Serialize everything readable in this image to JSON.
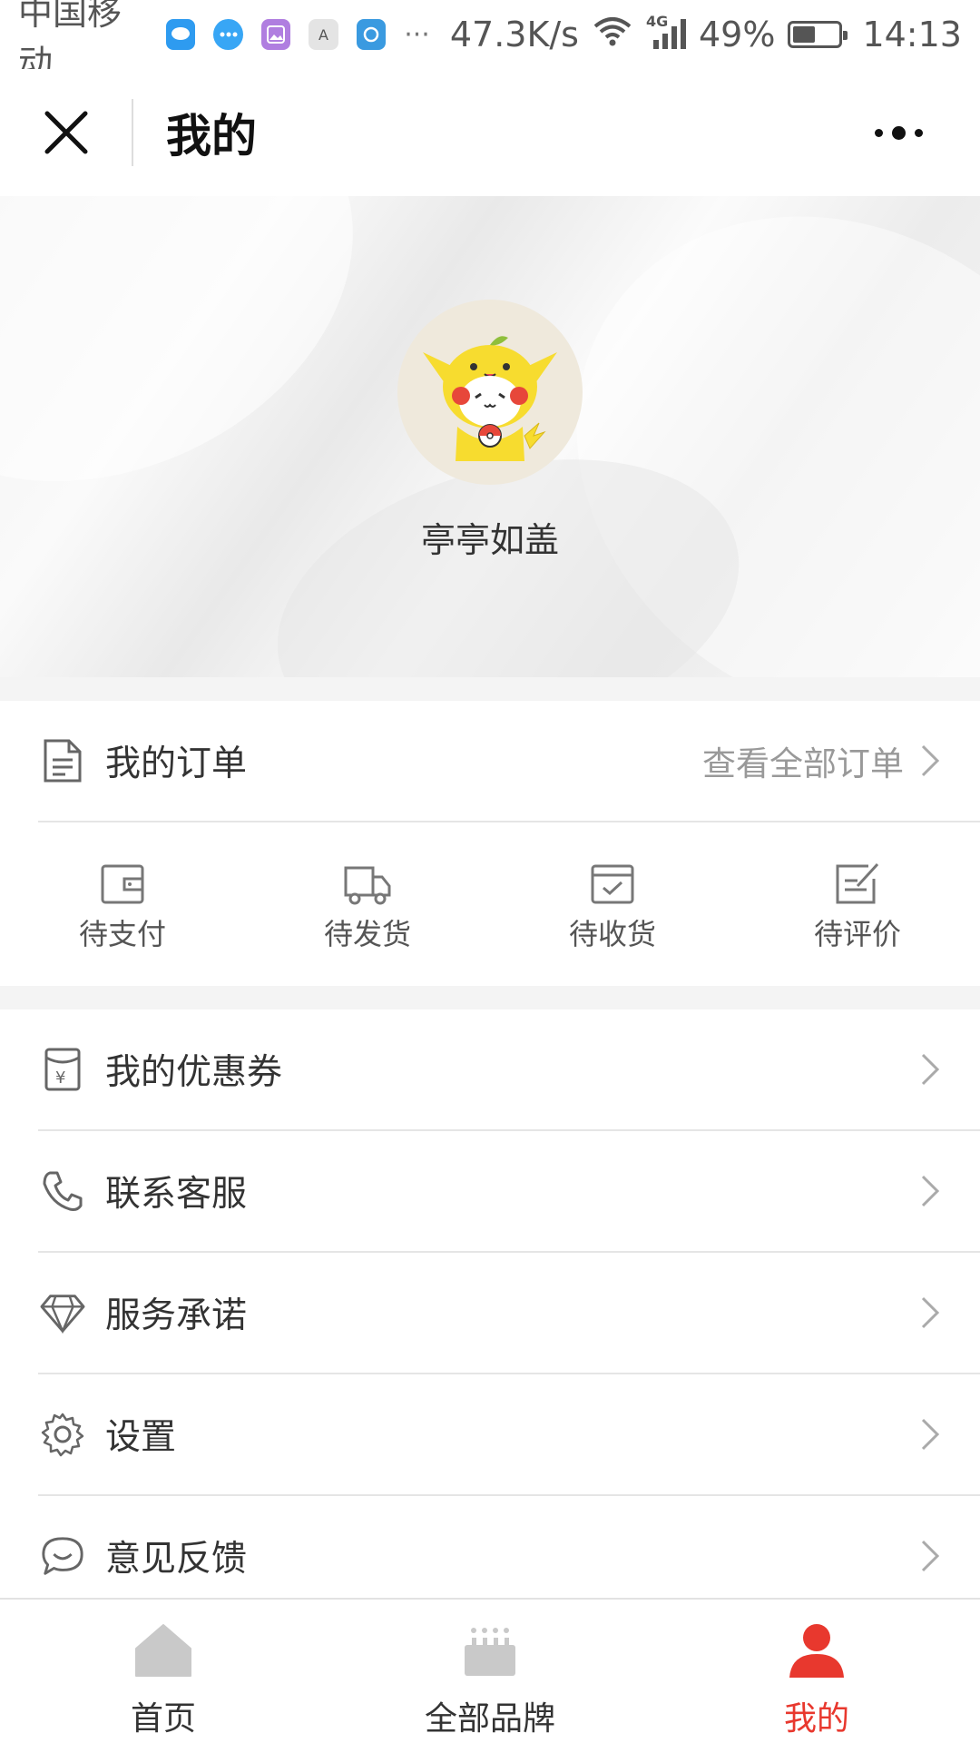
{
  "status_bar": {
    "carrier": "中国移动",
    "more": "···",
    "speed": "47.3K/s",
    "network": "4G",
    "battery": "49%",
    "battery_level": 0.49,
    "time": "14:13",
    "notification_icons": [
      "chat-bubble-icon",
      "message-icon",
      "gallery-icon",
      "keyboard-icon",
      "app-circle-icon"
    ]
  },
  "header": {
    "title": "我的",
    "close_icon": "close-icon",
    "more_icon": "more-dots-icon"
  },
  "profile": {
    "nickname": "亭亭如盖",
    "avatar_icon": "pikachu-avatar"
  },
  "orders": {
    "title": "我的订单",
    "view_all": "查看全部订单",
    "statuses": [
      {
        "label": "待支付",
        "icon": "wallet-icon"
      },
      {
        "label": "待发货",
        "icon": "truck-icon"
      },
      {
        "label": "待收货",
        "icon": "package-check-icon"
      },
      {
        "label": "待评价",
        "icon": "edit-note-icon"
      }
    ]
  },
  "menu": [
    {
      "label": "我的优惠券",
      "icon": "coupon-icon"
    },
    {
      "label": "联系客服",
      "icon": "phone-icon"
    },
    {
      "label": "服务承诺",
      "icon": "diamond-icon"
    },
    {
      "label": "设置",
      "icon": "gear-icon"
    },
    {
      "label": "意见反馈",
      "icon": "feedback-bubble-icon"
    }
  ],
  "tabs": [
    {
      "label": "首页",
      "icon": "home-icon",
      "active": false
    },
    {
      "label": "全部品牌",
      "icon": "brands-icon",
      "active": false
    },
    {
      "label": "我的",
      "icon": "user-icon",
      "active": true
    }
  ],
  "colors": {
    "accent": "#e8382e",
    "inactive_icon": "#c9c9c9",
    "text": "#333333",
    "hint": "#999999"
  }
}
